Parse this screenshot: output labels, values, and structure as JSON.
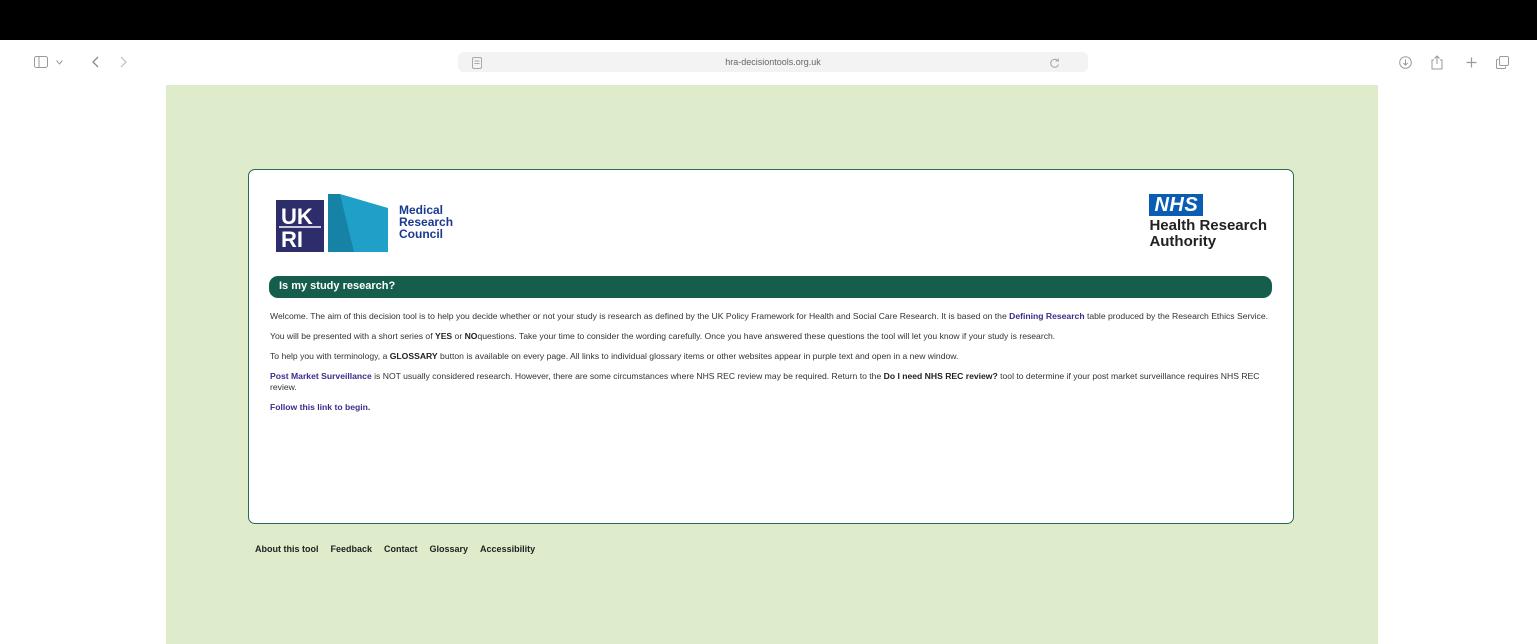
{
  "browser": {
    "url": "hra-decisiontools.org.uk",
    "icons": [
      "sidebar-icon",
      "chevron-down-icon",
      "back-icon",
      "forward-icon",
      "page-icon",
      "reload-icon",
      "download-icon",
      "share-icon",
      "new-tab-icon",
      "tabs-icon"
    ]
  },
  "header": {
    "mrc_line1": "Medical",
    "mrc_line2": "Research",
    "mrc_line3": "Council",
    "nhs_badge": "NHS",
    "nhs_line1": "Health Research",
    "nhs_line2": "Authority",
    "ukri_letters_top": "UK",
    "ukri_letters_bottom": "RI"
  },
  "main": {
    "title": "Is my study research?",
    "p1_a": "Welcome. The aim of this decision tool is to help you decide whether or not your study is research as defined by the UK Policy Framework for Health and Social Care Research. It is based on the ",
    "p1_link": "Defining Research",
    "p1_b": " table produced by the Research Ethics Service.",
    "p2_a": "You will be presented with a short series of ",
    "p2_yes": "YES",
    "p2_or": " or ",
    "p2_no": "NO",
    "p2_b": "questions. Take your time to consider the wording carefully. Once you have answered these questions the tool will let you know if your study is research.",
    "p3_a": "To help you with terminology, a ",
    "p3_glossary": "GLOSSARY",
    "p3_b": " button is available on every page. All links to individual glossary items or other websites appear in purple text and open in a new window.",
    "p4_link": "Post Market Surveillance",
    "p4_a": " is NOT usually considered research. However, there are some circumstances where NHS REC review may be required. Return to the ",
    "p4_tool": "Do I need NHS REC review?",
    "p4_b": " tool to determine if your post market surveillance requires NHS REC review.",
    "begin_link": "Follow this link to begin."
  },
  "footer": {
    "links": [
      "About this tool",
      "Feedback",
      "Contact",
      "Glossary",
      "Accessibility"
    ]
  },
  "colors": {
    "page_bg": "#deeccb",
    "green_bar": "#155e4c",
    "link_purple": "#3a2d8a",
    "nhs_blue": "#0b5db4",
    "card_border": "#2b6b57"
  }
}
